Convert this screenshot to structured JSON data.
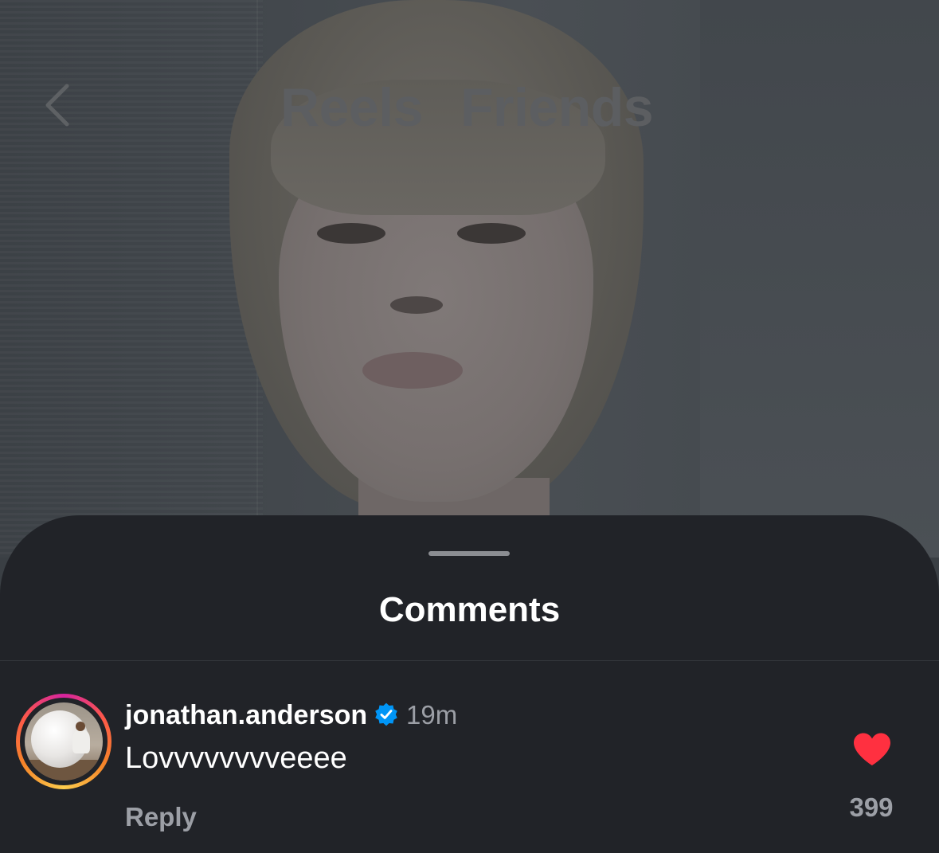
{
  "nav": {
    "tabs": [
      {
        "label": "Reels"
      },
      {
        "label": "Friends"
      }
    ],
    "back_icon": "chevron-left-icon"
  },
  "comments_sheet": {
    "title": "Comments",
    "comments": [
      {
        "username": "jonathan.anderson",
        "verified": true,
        "time": "19m",
        "text": "Lovvvvvvvveeee",
        "reply_label": "Reply",
        "liked": true,
        "like_count": "399"
      }
    ]
  },
  "colors": {
    "sheet_background": "#212328",
    "like_red": "#ff3040",
    "verified_blue": "#0095f6",
    "secondary_text": "#9c9fa6"
  }
}
